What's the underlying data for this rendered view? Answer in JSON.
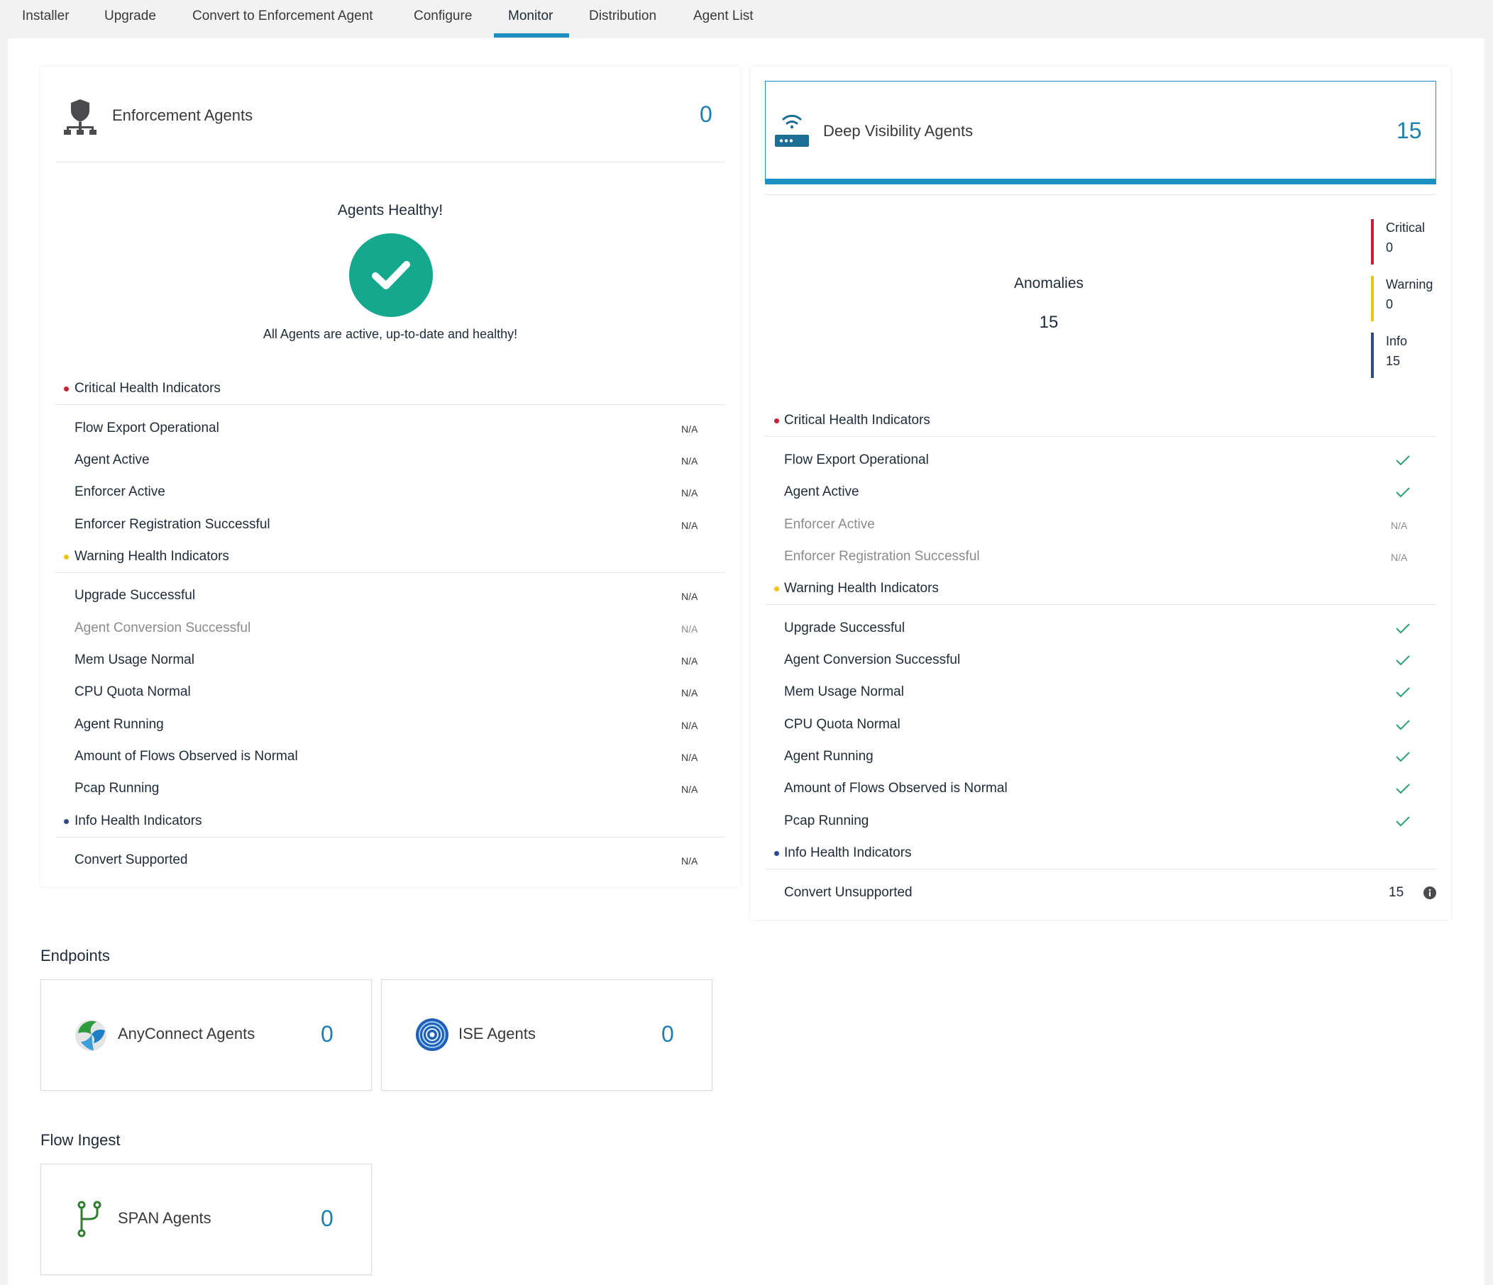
{
  "tabs": [
    {
      "label": "Installer"
    },
    {
      "label": "Upgrade"
    },
    {
      "label": "Convert to Enforcement Agent"
    },
    {
      "label": "Configure"
    },
    {
      "label": "Monitor"
    },
    {
      "label": "Distribution"
    },
    {
      "label": "Agent List"
    }
  ],
  "enforcement": {
    "title": "Enforcement Agents",
    "count": "0",
    "icon": "network-shield-icon",
    "healthy_title": "Agents Healthy!",
    "healthy_sub": "All Agents are active, up-to-date and healthy!",
    "critical_title": "Critical Health Indicators",
    "critical": [
      {
        "label": "Flow Export Operational",
        "value": "N/A"
      },
      {
        "label": "Agent Active",
        "value": "N/A"
      },
      {
        "label": "Enforcer Active",
        "value": "N/A"
      },
      {
        "label": "Enforcer Registration Successful",
        "value": "N/A"
      }
    ],
    "warning_title": "Warning Health Indicators",
    "warning": [
      {
        "label": "Upgrade Successful",
        "value": "N/A"
      },
      {
        "label": "Agent Conversion Successful",
        "value": "N/A"
      },
      {
        "label": "Mem Usage Normal",
        "value": "N/A"
      },
      {
        "label": "CPU Quota Normal",
        "value": "N/A"
      },
      {
        "label": "Agent Running",
        "value": "N/A"
      },
      {
        "label": "Amount of Flows Observed is Normal",
        "value": "N/A"
      },
      {
        "label": "Pcap Running",
        "value": "N/A"
      }
    ],
    "info_title": "Info Health Indicators",
    "info": [
      {
        "label": "Convert Supported",
        "value": "N/A"
      }
    ]
  },
  "deep_visibility": {
    "title": "Deep Visibility Agents",
    "count": "15",
    "icon": "router-wifi-icon",
    "anomalies_title": "Anomalies",
    "anomalies_count": "15",
    "severity": {
      "critical_label": "Critical",
      "critical_value": "0",
      "warning_label": "Warning",
      "warning_value": "0",
      "info_label": "Info",
      "info_value": "15"
    },
    "critical_title": "Critical Health Indicators",
    "critical": [
      {
        "label": "Flow Export Operational",
        "status": "check"
      },
      {
        "label": "Agent Active",
        "status": "check"
      },
      {
        "label": "Enforcer Active",
        "value": "N/A"
      },
      {
        "label": "Enforcer Registration Successful",
        "value": "N/A"
      }
    ],
    "warning_title": "Warning Health Indicators",
    "warning": [
      {
        "label": "Upgrade Successful",
        "status": "check"
      },
      {
        "label": "Agent Conversion Successful",
        "status": "check"
      },
      {
        "label": "Mem Usage Normal",
        "status": "check"
      },
      {
        "label": "CPU Quota Normal",
        "status": "check"
      },
      {
        "label": "Agent Running",
        "status": "check"
      },
      {
        "label": "Amount of Flows Observed is Normal",
        "status": "check"
      },
      {
        "label": "Pcap Running",
        "status": "check"
      }
    ],
    "info_title": "Info Health Indicators",
    "info": [
      {
        "label": "Convert Unsupported",
        "value": "15"
      }
    ]
  },
  "endpoints": {
    "heading": "Endpoints",
    "anyconnect": {
      "title": "AnyConnect Agents",
      "count": "0"
    },
    "ise": {
      "title": "ISE Agents",
      "count": "0"
    }
  },
  "flow_ingest": {
    "heading": "Flow Ingest",
    "span": {
      "title": "SPAN Agents",
      "count": "0"
    }
  },
  "colors": {
    "accent": "#1d8fc1",
    "count_blue": "#1d7fae",
    "healthy_green": "#14a88e",
    "check_green": "#2e9e74",
    "critical_red": "#c8202f",
    "warning_yellow": "#f0c30f",
    "info_blue": "#2f4a8a"
  }
}
